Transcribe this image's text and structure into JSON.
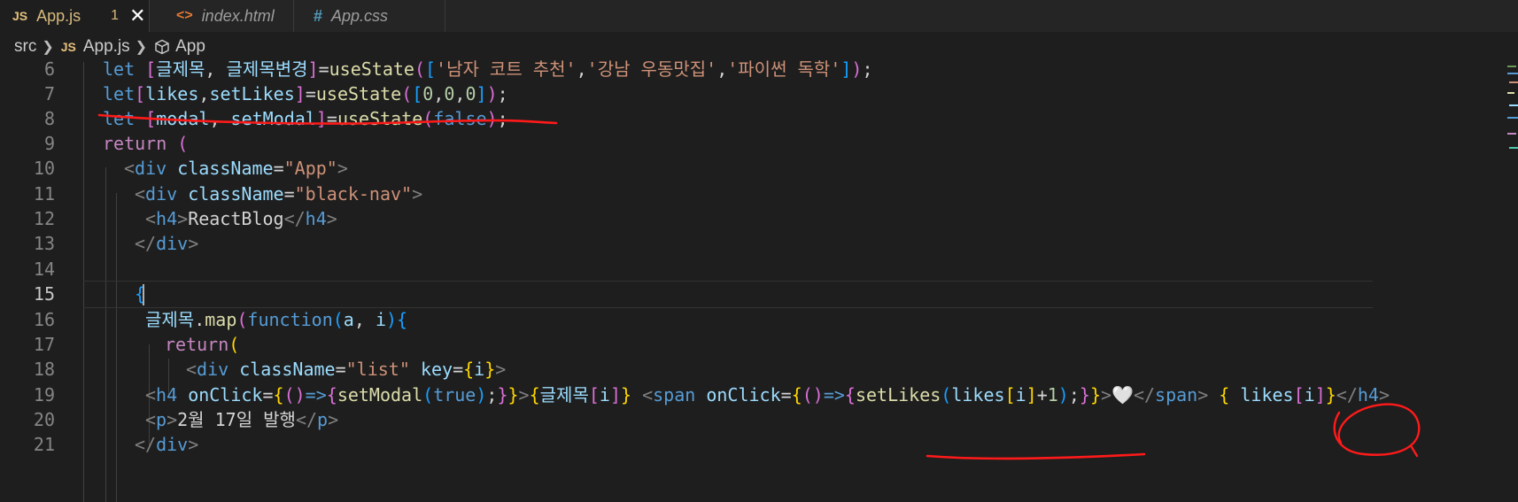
{
  "tabs": [
    {
      "icon": "JS",
      "label": "App.js",
      "badge": "1",
      "close": "✕",
      "active": true
    },
    {
      "icon": "<>",
      "label": "index.html",
      "active": false
    },
    {
      "icon": "#",
      "label": "App.css",
      "active": false
    }
  ],
  "breadcrumb": {
    "folder": "src",
    "file_icon": "JS",
    "file": "App.js",
    "symbol": "App"
  },
  "editor": {
    "line_numbers": [
      "6",
      "7",
      "8",
      "9",
      "10",
      "11",
      "12",
      "13",
      "14",
      "15",
      "16",
      "17",
      "18",
      "19",
      "20",
      "21"
    ],
    "current_line": "15",
    "lines": {
      "l6": [
        "let",
        " ",
        "[",
        "글제목",
        ", ",
        "글제목변경",
        "]",
        "=",
        "useState",
        "(",
        "[",
        "'남자 코트 추천'",
        ",",
        "'강남 우동맛집'",
        ",",
        "'파이썬 독학'",
        "]",
        ")",
        ";"
      ],
      "l7": [
        "let",
        "[",
        "likes",
        ",",
        "setLikes",
        "]",
        "=",
        "useState",
        "(",
        "[",
        "0",
        ",",
        "0",
        ",",
        "0",
        "]",
        ")",
        ";"
      ],
      "l8": [
        "let",
        " ",
        "[",
        "modal",
        ", ",
        "setModal",
        "]",
        "=",
        "useState",
        "(",
        "false",
        ")",
        ";"
      ],
      "l9": [
        "return",
        " ",
        "("
      ],
      "l10": [
        "<",
        "div",
        " ",
        "className",
        "=",
        "\"App\"",
        ">"
      ],
      "l11": [
        "<",
        "div",
        " ",
        "className",
        "=",
        "\"black-nav\"",
        ">"
      ],
      "l12": [
        "<",
        "h4",
        ">",
        "ReactBlog",
        "</",
        "h4",
        ">"
      ],
      "l13": [
        "</",
        "div",
        ">"
      ],
      "l15": [
        "{"
      ],
      "l16": [
        "글제목",
        ".",
        "map",
        "(",
        "function",
        "(",
        "a",
        ", ",
        "i",
        ")",
        "{"
      ],
      "l17": [
        "return",
        "("
      ],
      "l18": [
        "<",
        "div",
        " ",
        "className",
        "=",
        "\"list\"",
        " ",
        "key",
        "=",
        "{",
        "i",
        "}",
        ">"
      ],
      "l19": [
        "<",
        "h4",
        " ",
        "onClick",
        "=",
        "{",
        "(",
        ")",
        "=>",
        "{",
        "setModal",
        "(",
        "true",
        ")",
        ";",
        "}",
        "}",
        ">",
        "{",
        "글제목",
        "[",
        "i",
        "]",
        "}",
        " ",
        "<",
        "span",
        " ",
        "onClick",
        "=",
        "{",
        "(",
        ")",
        "=>",
        "{",
        "setLikes",
        "(",
        "likes",
        "[",
        "i",
        "]",
        "+",
        "1",
        ")",
        ";",
        "}",
        "}",
        ">",
        "🤍",
        "</",
        "span",
        ">",
        " ",
        "{",
        " ",
        "likes",
        "[",
        "i",
        "]",
        "}",
        "</",
        "h4",
        ">"
      ],
      "l20": [
        "<",
        "p",
        ">",
        "2월 17일 발행",
        "</",
        "p",
        ">"
      ],
      "l21": [
        "</",
        "div",
        ">"
      ]
    }
  },
  "colors": {
    "background": "#1e1e1e",
    "tabbar": "#252526",
    "annotation": "#ff1a1a",
    "keyword": "#569cd6",
    "string": "#ce9178",
    "function": "#dcdcaa",
    "variable": "#9cdcfe"
  },
  "icons": [
    "js-file-icon",
    "html-file-icon",
    "css-file-icon",
    "close-icon",
    "chevron-right-icon",
    "symbol-cube-icon"
  ]
}
